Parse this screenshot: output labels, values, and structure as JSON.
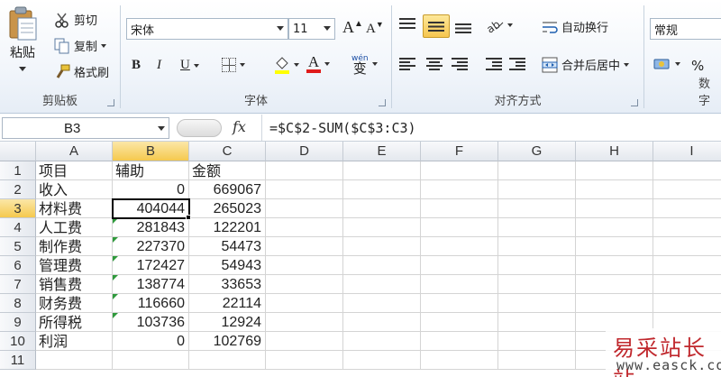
{
  "ribbon": {
    "clipboard": {
      "paste_label": "粘贴",
      "cut_label": "剪切",
      "copy_label": "复制",
      "format_painter_label": "格式刷",
      "group_label": "剪贴板"
    },
    "font": {
      "font_name": "宋体",
      "font_size": "11",
      "group_label": "字体",
      "bold": "B",
      "italic": "I",
      "underline": "U",
      "font_color_glyph": "A",
      "wen_glyph": "变"
    },
    "alignment": {
      "wrap_text_label": "自动换行",
      "merge_center_label": "合并后居中",
      "group_label": "对齐方式"
    },
    "number": {
      "format_value": "常规",
      "percent": "%",
      "group_label": "数字"
    }
  },
  "formula_bar": {
    "name_box": "B3",
    "fx": "fx",
    "formula": "=$C$2-SUM($C$3:C3)"
  },
  "sheet": {
    "columns": [
      "A",
      "B",
      "C",
      "D",
      "E",
      "F",
      "G",
      "H",
      "I"
    ],
    "rows": [
      "1",
      "2",
      "3",
      "4",
      "5",
      "6",
      "7",
      "8",
      "9",
      "10",
      "11"
    ],
    "data": [
      [
        "项目",
        "辅助",
        "金额"
      ],
      [
        "收入",
        "0",
        "669067"
      ],
      [
        "材料费",
        "404044",
        "265023"
      ],
      [
        "人工费",
        "281843",
        "122201"
      ],
      [
        "制作费",
        "227370",
        "54473"
      ],
      [
        "管理费",
        "172427",
        "54943"
      ],
      [
        "销售费",
        "138774",
        "33653"
      ],
      [
        "财务费",
        "116660",
        "22114"
      ],
      [
        "所得税",
        "103736",
        "12924"
      ],
      [
        "利润",
        "0",
        "102769"
      ],
      [
        "",
        "",
        ""
      ]
    ],
    "active_cell": "B3",
    "colors": {
      "selected_header": "#f5c94e",
      "error_indicator": "#2f9a3c"
    }
  },
  "watermark": {
    "title": "易采站长站",
    "url": "www.easck.com"
  }
}
